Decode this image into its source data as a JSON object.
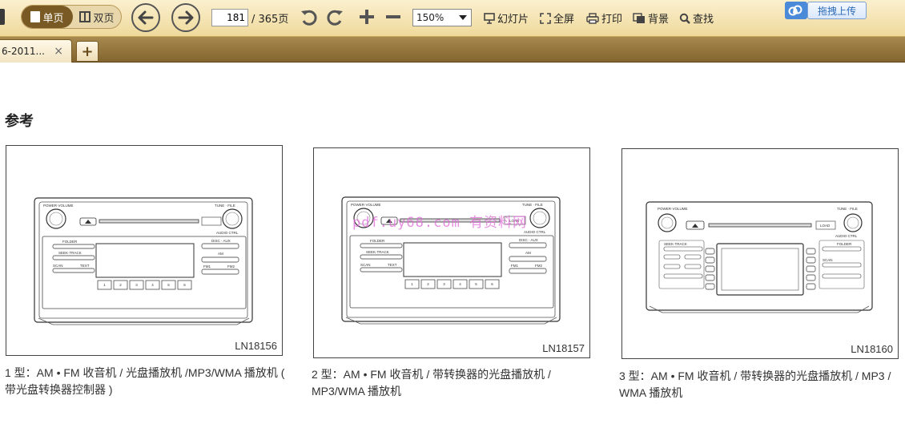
{
  "toolbar": {
    "single_page_label": "单页",
    "double_page_label": "双页",
    "page_current": "181",
    "page_total": "/ 365页",
    "zoom_value": "150%",
    "zoom_options": [
      "150%"
    ],
    "slideshow_label": "幻灯片",
    "fullscreen_label": "全屏",
    "print_label": "打印",
    "background_label": "背景",
    "find_label": "查找",
    "upload_label": "拖拽上传"
  },
  "tabs": [
    {
      "label": "6-2011...",
      "close": "×"
    }
  ],
  "new_tab_label": "+",
  "document": {
    "heading": "参考",
    "watermark": "pdf.uy68.com 有资料网",
    "figures": [
      {
        "code": "LN18156",
        "caption": "1 型：AM • FM 收音机 / 光盘播放机 /MP3/WMA 播放机 ( 带光盘转换器控制器 )"
      },
      {
        "code": "LN18157",
        "caption": "2 型：AM • FM 收音机 / 带转换器的光盘播放机 / MP3/WMA 播放机"
      },
      {
        "code": "LN18160",
        "caption": "3 型：AM • FM 收音机 / 带转换器的光盘播放机 / MP3 / WMA 播放机"
      }
    ],
    "radio_labels": {
      "power_volume": "POWER·VOLUME",
      "tune_file": "TUNE · FILE",
      "folder": "FOLDER",
      "seek_track": "SEEK·TRACK",
      "scan": "SCAN",
      "text": "TEXT",
      "disc_aux": "DISC · AUX",
      "am": "AM",
      "fm1": "FM1",
      "fm2": "FM2",
      "load": "LOAD",
      "audio_ctrl": "AUDIO CTRL",
      "presets": [
        "1",
        "2",
        "3",
        "4",
        "5",
        "6"
      ]
    }
  },
  "colors": {
    "toolbar_bg": "#f2dfa8",
    "tabbar_bg": "#94763d",
    "upload_bg": "#4a8ad8"
  }
}
